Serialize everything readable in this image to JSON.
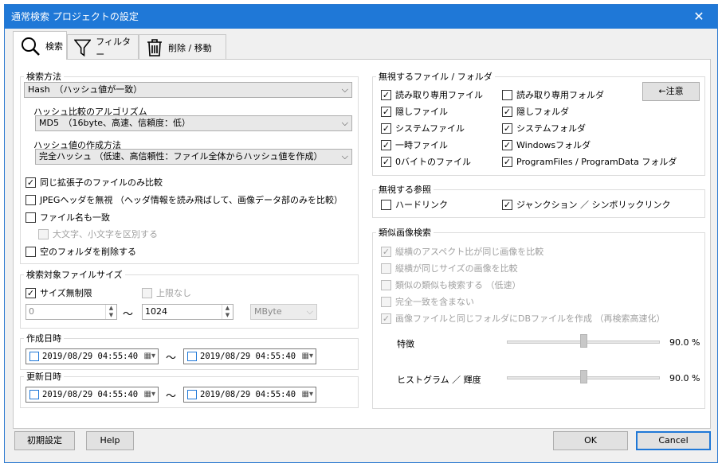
{
  "window": {
    "title": "通常検索 プロジェクトの設定",
    "close": "✕"
  },
  "tabs": [
    {
      "label": "検索"
    },
    {
      "label": "フィルター"
    },
    {
      "label": "削除 / 移動"
    }
  ],
  "search_method": {
    "title": "検索方法",
    "method": "Hash　（ハッシュ値が一致）",
    "algo_label": "ハッシュ比較のアルゴリズム",
    "algo_value": "MD5　（16byte、高速、信頼度：低）",
    "creation_label": "ハッシュ値の作成方法",
    "creation_value": "完全ハッシュ （低速、高信頼性：ファイル全体からハッシュ値を作成）",
    "options": [
      {
        "label": "同じ拡張子のファイルのみ比較",
        "checked": true
      },
      {
        "label": "JPEGヘッダを無視 （ヘッダ情報を読み飛ばして、画像データ部のみを比較）",
        "checked": false
      },
      {
        "label": "ファイル名も一致",
        "checked": false
      },
      {
        "label": "大文字、小文字を区別する",
        "checked": false
      },
      {
        "label": "空のフォルダを削除する",
        "checked": false
      }
    ]
  },
  "size": {
    "title": "検索対象ファイルサイズ",
    "no_limit": "サイズ無制限",
    "no_upper": "上限なし",
    "min": "0",
    "max": "1024",
    "tilde": "～",
    "unit": "MByte"
  },
  "created": {
    "title": "作成日時",
    "from": "2019/08/29 04:55:40",
    "to": "2019/08/29 04:55:40"
  },
  "updated": {
    "title": "更新日時",
    "from": "2019/08/29 04:55:40",
    "to": "2019/08/29 04:55:40"
  },
  "ignore_files": {
    "title": "無視するファイル / フォルダ",
    "note_btn": "←注意",
    "left": [
      {
        "label": "読み取り専用ファイル",
        "checked": true
      },
      {
        "label": "隠しファイル",
        "checked": true
      },
      {
        "label": "システムファイル",
        "checked": true
      },
      {
        "label": "一時ファイル",
        "checked": true
      },
      {
        "label": "0バイトのファイル",
        "checked": true
      }
    ],
    "right": [
      {
        "label": "読み取り専用フォルダ",
        "checked": false
      },
      {
        "label": "隠しフォルダ",
        "checked": true
      },
      {
        "label": "システムフォルダ",
        "checked": true
      },
      {
        "label": "Windowsフォルダ",
        "checked": true
      },
      {
        "label": "ProgramFiles / ProgramData フォルダ",
        "checked": true
      }
    ]
  },
  "ignore_refs": {
    "title": "無視する参照",
    "hardlink": "ハードリンク",
    "hardlink_checked": false,
    "junction": "ジャンクション ／ シンボリックリンク",
    "junction_checked": true
  },
  "similar": {
    "title": "類似画像検索",
    "options": [
      {
        "label": "縦横のアスペクト比が同じ画像を比較",
        "checked": true
      },
      {
        "label": "縦横が同じサイズの画像を比較",
        "checked": false
      },
      {
        "label": "類似の類似も検索する （低速）",
        "checked": false
      },
      {
        "label": "完全一致を含まない",
        "checked": false
      },
      {
        "label": "画像ファイルと同じフォルダにDBファイルを作成 （再検索高速化）",
        "checked": true
      }
    ],
    "feature_label": "特徴",
    "feature_value": "90.0 %",
    "feature_level": 0.5,
    "hist_label": "ヒストグラム ／ 輝度",
    "hist_value": "90.0 %",
    "hist_level": 0.5
  },
  "buttons": {
    "init": "初期設定",
    "help": "Help",
    "ok": "OK",
    "cancel": "Cancel"
  }
}
